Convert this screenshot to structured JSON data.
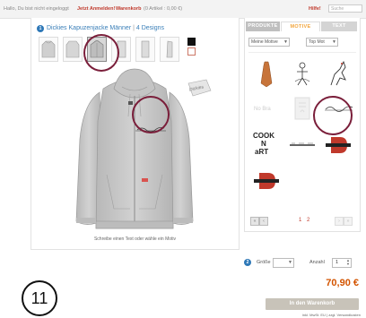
{
  "topbar": {
    "greeting": "Hallo, Du bist nicht eingeloggt",
    "login_link": "Jetzt Anmelden!",
    "cart_link": "Warenkorb",
    "cart_info": "(0 Artikel : 0,00 €)",
    "help_link": "Hilfe!",
    "search_placeholder": "Suche"
  },
  "product": {
    "step": "1",
    "name": "Dickies Kapuzenjacke Männer",
    "designs": "4 Designs",
    "caption": "Schreibe einen Text oder wähle ein Motiv",
    "tag": "Dickies",
    "selected_thumb_index": 2
  },
  "right_panel": {
    "tabs": [
      "PRODUKTE",
      "MOTIVE",
      "TEXT"
    ],
    "active_tab": "MOTIVE",
    "filter_1": "Meine Motive",
    "filter_2": "Top Mot",
    "motifs": [
      "tie-motif",
      "figure-motif",
      "horse-motif",
      "faded-text-motif",
      "faded-card-motif",
      "signature-motif",
      "cook-n-art-motif",
      "small-text-motif",
      "red-d-logo-motif",
      "red-d-logo-motif-2"
    ],
    "motif_texts": {
      "cook": "COOK",
      "n": "N",
      "art": "aRT",
      "faded": "No Bra"
    },
    "pages": "1 2"
  },
  "order": {
    "step": "2",
    "size_label": "Größe",
    "quantity_label": "Anzahl",
    "quantity": "1",
    "price": "70,90 €",
    "cart_button": "In den Warenkorb",
    "tax_note": "inkl. MwSt. EU | zzgl. Versandkosten"
  },
  "step_badge": "11",
  "colors": {
    "accent_blue": "#2e78b7",
    "highlight_ring": "#7a1e3a",
    "price": "#d35400",
    "tab_active": "#f2a43a"
  }
}
